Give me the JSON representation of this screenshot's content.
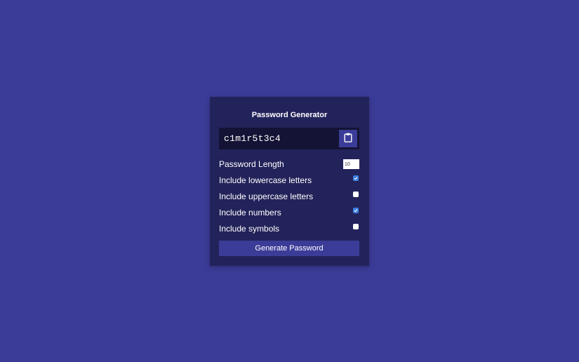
{
  "app": {
    "title": "Password Generator"
  },
  "result": {
    "password": "c1m1r5t3c4",
    "copy_icon": "clipboard-icon"
  },
  "settings": {
    "length": {
      "label": "Password Length",
      "value": "10"
    },
    "lowercase": {
      "label": "Include lowercase letters",
      "checked": true
    },
    "uppercase": {
      "label": "Include uppercase letters",
      "checked": false
    },
    "numbers": {
      "label": "Include numbers",
      "checked": true
    },
    "symbols": {
      "label": "Include symbols",
      "checked": false
    }
  },
  "actions": {
    "generate_label": "Generate Password"
  },
  "colors": {
    "background": "#3b3c98",
    "card": "#23235b",
    "result_box": "#141335",
    "checkbox_checked": "#3d7fe0"
  }
}
